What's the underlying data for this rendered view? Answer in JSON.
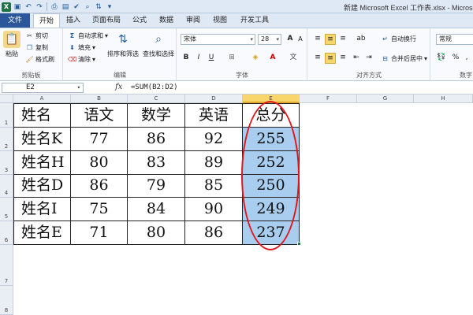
{
  "window": {
    "title": "新建 Microsoft Excel 工作表.xlsx - Microso",
    "qat_icons": [
      "excel-app-icon",
      "save-icon",
      "undo-icon",
      "redo-icon",
      "print-icon",
      "format-icon"
    ]
  },
  "tabs": [
    "文件",
    "开始",
    "插入",
    "页面布局",
    "公式",
    "数据",
    "审阅",
    "视图",
    "开发工具"
  ],
  "ribbon": {
    "clipboard": {
      "paste": "粘贴",
      "cut": "剪切",
      "copy": "复制",
      "format_painter": "格式刷",
      "label": "剪贴板"
    },
    "editing": {
      "autosum": "自动求和",
      "fill": "填充",
      "clear": "清除",
      "sort_filter": "排序和筛选",
      "find_select": "查找和选择",
      "label": "编辑"
    },
    "font": {
      "name": "宋体",
      "size": "28",
      "grow": "A",
      "shrink": "A",
      "bold": "B",
      "italic": "I",
      "underline": "U",
      "label": "字体"
    },
    "alignment": {
      "wrap": "自动换行",
      "merge": "合并后居中",
      "label": "对齐方式"
    },
    "number": {
      "format": "常规",
      "percent": "%",
      "comma": ",",
      "label": "数字"
    }
  },
  "formula_bar": {
    "name_box": "E2",
    "fx": "fx",
    "formula": "=SUM(B2:D2)"
  },
  "columns": [
    "A",
    "B",
    "C",
    "D",
    "E",
    "F",
    "G",
    "H"
  ],
  "rows": [
    "1",
    "2",
    "3",
    "4",
    "5",
    "6",
    "7",
    "8"
  ],
  "table": {
    "headers": [
      "姓名",
      "语文",
      "数学",
      "英语",
      "总分"
    ],
    "rows": [
      [
        "姓名K",
        "77",
        "86",
        "92",
        "255"
      ],
      [
        "姓名H",
        "80",
        "83",
        "89",
        "252"
      ],
      [
        "姓名D",
        "86",
        "79",
        "85",
        "250"
      ],
      [
        "姓名I",
        "75",
        "84",
        "90",
        "249"
      ],
      [
        "姓名E",
        "71",
        "80",
        "86",
        "237"
      ]
    ]
  },
  "colors": {
    "selection": "#a9cdef",
    "annotation": "#e0161c",
    "file_tab": "#2b579a",
    "active_col_header": "#f9d66b"
  },
  "selected_column": "E"
}
